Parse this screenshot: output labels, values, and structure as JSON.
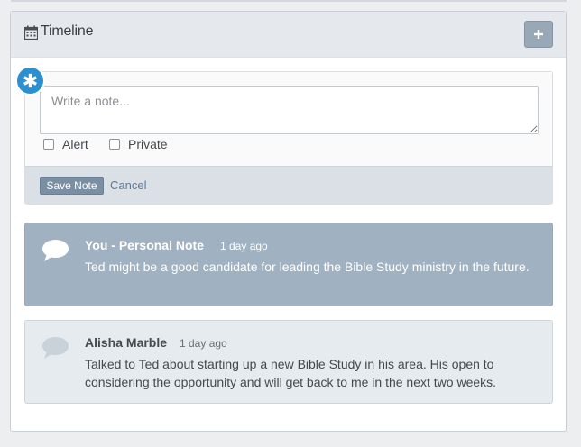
{
  "panel": {
    "title": "Timeline",
    "title_icon": "calendar-icon",
    "add_button_icon": "plus-icon"
  },
  "note_form": {
    "badge_icon": "asterisk-icon",
    "placeholder": "Write a note...",
    "alert_label": "Alert",
    "alert_checked": false,
    "private_label": "Private",
    "private_checked": false,
    "save_label": "Save Note",
    "cancel_label": "Cancel"
  },
  "timeline": {
    "items": [
      {
        "author": "You - Personal Note",
        "time": "1 day ago",
        "text": "Ted might be a good candidate for leading the Bible Study ministry in the future.",
        "icon": "comment-icon"
      },
      {
        "author": "Alisha Marble",
        "time": "1 day ago",
        "text": "Talked to Ted about starting up a new Bible Study in his area. His open to considering the opportunity and will get back to me in the next two weeks.",
        "icon": "comment-icon"
      }
    ]
  },
  "colors": {
    "accent": "#2b8fd0",
    "personal_note_bg": "#a0b1c2",
    "note_bg": "#e6ebf0",
    "save_button": "#7b8fa3"
  }
}
